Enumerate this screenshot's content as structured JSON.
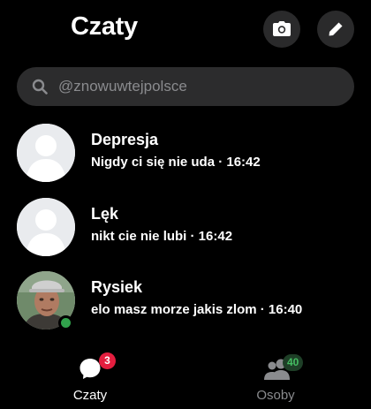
{
  "header": {
    "title": "Czaty",
    "camera_icon": "camera-icon",
    "edit_icon": "pencil-icon"
  },
  "search": {
    "placeholder": "@znowuwtejpolsce",
    "icon": "search-icon"
  },
  "chats": [
    {
      "name": "Depresja",
      "preview": "Nigdy ci się nie uda · 16:42",
      "avatar": "default-avatar",
      "online": false
    },
    {
      "name": "Lęk",
      "preview": "nikt cie nie lubi · 16:42",
      "avatar": "default-avatar",
      "online": false
    },
    {
      "name": "Rysiek",
      "preview": "elo masz morze jakis zlom · 16:40",
      "avatar": "photo-avatar",
      "online": true
    }
  ],
  "nav": {
    "chats_label": "Czaty",
    "chats_badge": "3",
    "people_label": "Osoby",
    "people_badge": "40"
  },
  "colors": {
    "background": "#000000",
    "search_bg": "#2c2c2d",
    "button_bg": "#2a2a2b",
    "online": "#31a24c",
    "badge_red": "#e41e3f",
    "badge_green": "#45bd62",
    "muted": "#8a8b8e"
  }
}
